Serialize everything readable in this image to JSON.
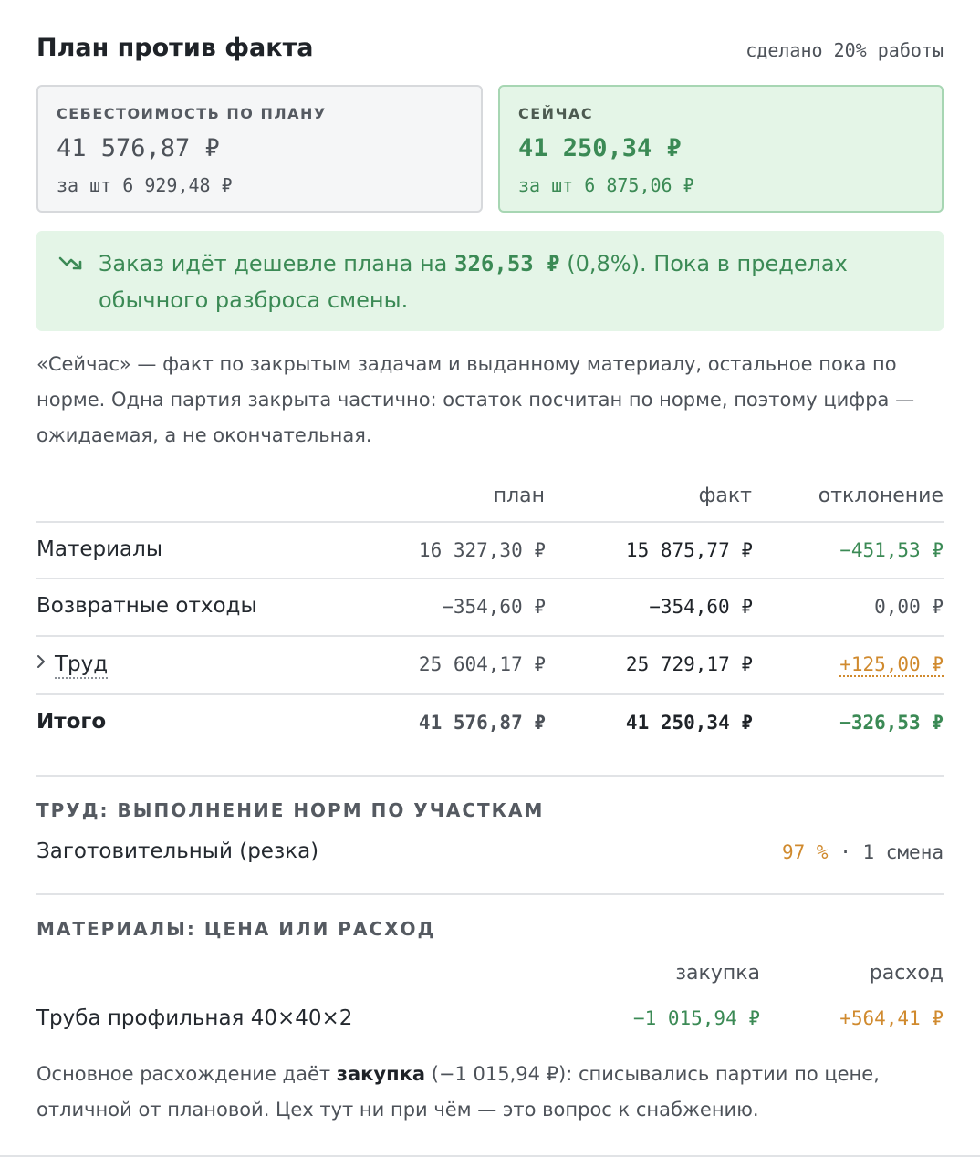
{
  "header": {
    "title": "План против факта",
    "progress": "сделано 20% работы"
  },
  "cards": {
    "plan": {
      "label": "СЕБЕСТОИМОСТЬ ПО ПЛАНУ",
      "value": "41 576,87 ₽",
      "per_unit": "за шт 6 929,48 ₽"
    },
    "now": {
      "label": "СЕЙЧАС",
      "value": "41 250,34 ₽",
      "per_unit": "за шт 6 875,06 ₽"
    }
  },
  "alert": {
    "icon": "trend-down-icon",
    "text_before": "Заказ идёт дешевле плана на ",
    "amount": "326,53 ₽",
    "text_after": " (0,8%). Пока в пределах обычного разброса смены."
  },
  "note": "«Сейчас» — факт по закрытым задачам и выданному материалу, остальное пока по норме. Одна партия закрыта частично: остаток посчитан по норме, поэтому цифра — ожидаемая, а не окончательная.",
  "table": {
    "columns": {
      "plan": "план",
      "fact": "факт",
      "deviation": "отклонение"
    },
    "rows": [
      {
        "label": "Материалы",
        "plan": "16 327,30 ₽",
        "fact": "15 875,77 ₽",
        "deviation": "−451,53 ₽"
      },
      {
        "label": "Возвратные отходы",
        "plan": "−354,60 ₽",
        "fact": "−354,60 ₽",
        "deviation": "0,00 ₽"
      },
      {
        "label": "Труд",
        "plan": "25 604,17 ₽",
        "fact": "25 729,17 ₽",
        "deviation": "+125,00 ₽"
      }
    ],
    "total": {
      "label": "Итого",
      "plan": "41 576,87 ₽",
      "fact": "41 250,34 ₽",
      "deviation": "−326,53 ₽"
    }
  },
  "labor_section": {
    "title": "ТРУД: ВЫПОЛНЕНИЕ НОРМ ПО УЧАСТКАМ",
    "items": [
      {
        "label": "Заготовительный (резка)",
        "percent": "97 %",
        "separator": " · ",
        "shifts": "1 смена"
      }
    ]
  },
  "materials_section": {
    "title": "МАТЕРИАЛЫ: ЦЕНА ИЛИ РАСХОД",
    "columns": {
      "purchase": "закупка",
      "consumption": "расход"
    },
    "items": [
      {
        "label": "Труба профильная 40×40×2",
        "purchase": "−1 015,94 ₽",
        "consumption": "+564,41 ₽"
      }
    ]
  },
  "footer": {
    "text_before": "Основное расхождение даёт ",
    "bold": "закупка",
    "text_after": " (−1 015,94 ₽): списывались партии по цене, отличной от плановой. Цех тут ни при чём — это вопрос к снабжению."
  },
  "colors": {
    "green": "#3b8a55",
    "orange": "#d08a2e",
    "card_now_bg": "#e4f5e7",
    "card_plan_bg": "#f5f6f7"
  }
}
